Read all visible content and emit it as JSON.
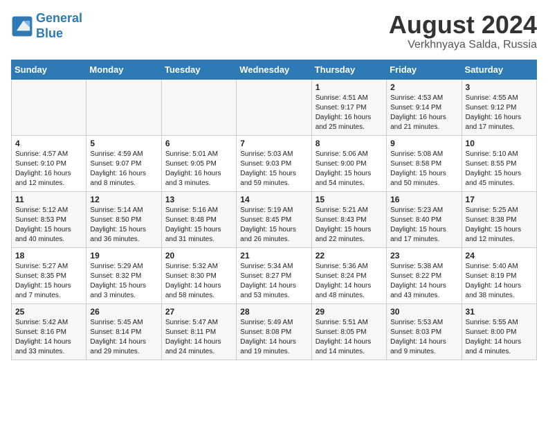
{
  "header": {
    "logo_line1": "General",
    "logo_line2": "Blue",
    "month": "August 2024",
    "location": "Verkhnyaya Salda, Russia"
  },
  "days_of_week": [
    "Sunday",
    "Monday",
    "Tuesday",
    "Wednesday",
    "Thursday",
    "Friday",
    "Saturday"
  ],
  "weeks": [
    [
      {
        "day": "",
        "content": ""
      },
      {
        "day": "",
        "content": ""
      },
      {
        "day": "",
        "content": ""
      },
      {
        "day": "",
        "content": ""
      },
      {
        "day": "1",
        "content": "Sunrise: 4:51 AM\nSunset: 9:17 PM\nDaylight: 16 hours\nand 25 minutes."
      },
      {
        "day": "2",
        "content": "Sunrise: 4:53 AM\nSunset: 9:14 PM\nDaylight: 16 hours\nand 21 minutes."
      },
      {
        "day": "3",
        "content": "Sunrise: 4:55 AM\nSunset: 9:12 PM\nDaylight: 16 hours\nand 17 minutes."
      }
    ],
    [
      {
        "day": "4",
        "content": "Sunrise: 4:57 AM\nSunset: 9:10 PM\nDaylight: 16 hours\nand 12 minutes."
      },
      {
        "day": "5",
        "content": "Sunrise: 4:59 AM\nSunset: 9:07 PM\nDaylight: 16 hours\nand 8 minutes."
      },
      {
        "day": "6",
        "content": "Sunrise: 5:01 AM\nSunset: 9:05 PM\nDaylight: 16 hours\nand 3 minutes."
      },
      {
        "day": "7",
        "content": "Sunrise: 5:03 AM\nSunset: 9:03 PM\nDaylight: 15 hours\nand 59 minutes."
      },
      {
        "day": "8",
        "content": "Sunrise: 5:06 AM\nSunset: 9:00 PM\nDaylight: 15 hours\nand 54 minutes."
      },
      {
        "day": "9",
        "content": "Sunrise: 5:08 AM\nSunset: 8:58 PM\nDaylight: 15 hours\nand 50 minutes."
      },
      {
        "day": "10",
        "content": "Sunrise: 5:10 AM\nSunset: 8:55 PM\nDaylight: 15 hours\nand 45 minutes."
      }
    ],
    [
      {
        "day": "11",
        "content": "Sunrise: 5:12 AM\nSunset: 8:53 PM\nDaylight: 15 hours\nand 40 minutes."
      },
      {
        "day": "12",
        "content": "Sunrise: 5:14 AM\nSunset: 8:50 PM\nDaylight: 15 hours\nand 36 minutes."
      },
      {
        "day": "13",
        "content": "Sunrise: 5:16 AM\nSunset: 8:48 PM\nDaylight: 15 hours\nand 31 minutes."
      },
      {
        "day": "14",
        "content": "Sunrise: 5:19 AM\nSunset: 8:45 PM\nDaylight: 15 hours\nand 26 minutes."
      },
      {
        "day": "15",
        "content": "Sunrise: 5:21 AM\nSunset: 8:43 PM\nDaylight: 15 hours\nand 22 minutes."
      },
      {
        "day": "16",
        "content": "Sunrise: 5:23 AM\nSunset: 8:40 PM\nDaylight: 15 hours\nand 17 minutes."
      },
      {
        "day": "17",
        "content": "Sunrise: 5:25 AM\nSunset: 8:38 PM\nDaylight: 15 hours\nand 12 minutes."
      }
    ],
    [
      {
        "day": "18",
        "content": "Sunrise: 5:27 AM\nSunset: 8:35 PM\nDaylight: 15 hours\nand 7 minutes."
      },
      {
        "day": "19",
        "content": "Sunrise: 5:29 AM\nSunset: 8:32 PM\nDaylight: 15 hours\nand 3 minutes."
      },
      {
        "day": "20",
        "content": "Sunrise: 5:32 AM\nSunset: 8:30 PM\nDaylight: 14 hours\nand 58 minutes."
      },
      {
        "day": "21",
        "content": "Sunrise: 5:34 AM\nSunset: 8:27 PM\nDaylight: 14 hours\nand 53 minutes."
      },
      {
        "day": "22",
        "content": "Sunrise: 5:36 AM\nSunset: 8:24 PM\nDaylight: 14 hours\nand 48 minutes."
      },
      {
        "day": "23",
        "content": "Sunrise: 5:38 AM\nSunset: 8:22 PM\nDaylight: 14 hours\nand 43 minutes."
      },
      {
        "day": "24",
        "content": "Sunrise: 5:40 AM\nSunset: 8:19 PM\nDaylight: 14 hours\nand 38 minutes."
      }
    ],
    [
      {
        "day": "25",
        "content": "Sunrise: 5:42 AM\nSunset: 8:16 PM\nDaylight: 14 hours\nand 33 minutes."
      },
      {
        "day": "26",
        "content": "Sunrise: 5:45 AM\nSunset: 8:14 PM\nDaylight: 14 hours\nand 29 minutes."
      },
      {
        "day": "27",
        "content": "Sunrise: 5:47 AM\nSunset: 8:11 PM\nDaylight: 14 hours\nand 24 minutes."
      },
      {
        "day": "28",
        "content": "Sunrise: 5:49 AM\nSunset: 8:08 PM\nDaylight: 14 hours\nand 19 minutes."
      },
      {
        "day": "29",
        "content": "Sunrise: 5:51 AM\nSunset: 8:05 PM\nDaylight: 14 hours\nand 14 minutes."
      },
      {
        "day": "30",
        "content": "Sunrise: 5:53 AM\nSunset: 8:03 PM\nDaylight: 14 hours\nand 9 minutes."
      },
      {
        "day": "31",
        "content": "Sunrise: 5:55 AM\nSunset: 8:00 PM\nDaylight: 14 hours\nand 4 minutes."
      }
    ]
  ]
}
